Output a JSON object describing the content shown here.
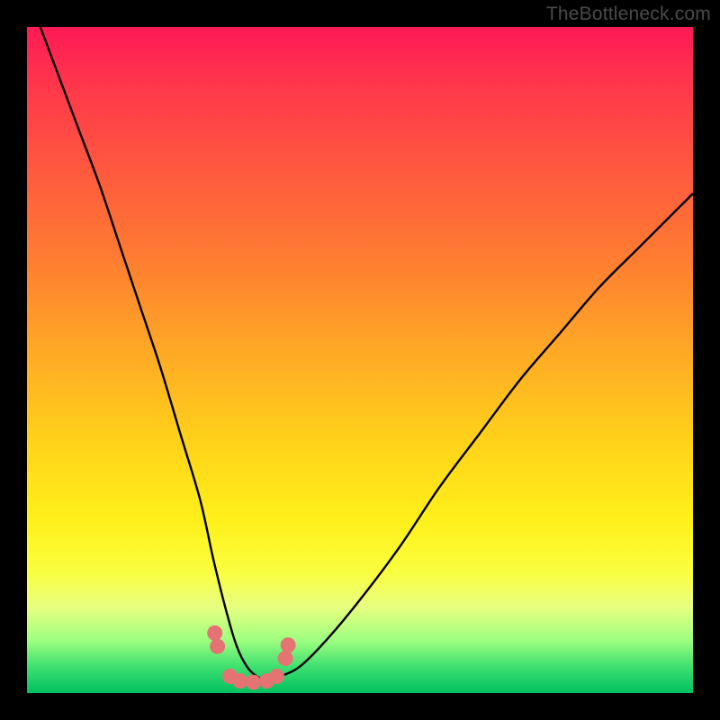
{
  "watermark": "TheBottleneck.com",
  "chart_data": {
    "type": "line",
    "title": "",
    "xlabel": "",
    "ylabel": "",
    "xlim": [
      0,
      100
    ],
    "ylim": [
      0,
      100
    ],
    "grid": false,
    "legend": false,
    "series": [
      {
        "name": "bottleneck-curve",
        "color": "#000000",
        "x": [
          2,
          5,
          8,
          11,
          14,
          17,
          20,
          23,
          26,
          28,
          30,
          31.5,
          33,
          34.5,
          36,
          38,
          41,
          45,
          50,
          56,
          62,
          68,
          74,
          80,
          86,
          92,
          98,
          100
        ],
        "y": [
          100,
          92,
          84,
          76,
          67,
          58,
          49,
          39,
          29,
          20,
          12,
          7,
          4,
          2.5,
          2,
          2.5,
          4,
          8,
          14,
          22,
          31,
          39,
          47,
          54,
          61,
          67,
          73,
          75
        ]
      },
      {
        "name": "marker-dots",
        "color": "#e57373",
        "type": "scatter",
        "x": [
          28.2,
          28.6,
          30.5,
          32.0,
          34.0,
          36.0,
          37.5,
          38.8,
          39.2
        ],
        "y": [
          9.0,
          7.0,
          2.5,
          1.8,
          1.6,
          1.8,
          2.5,
          5.2,
          7.2
        ]
      }
    ],
    "annotations": []
  },
  "colors": {
    "curve": "#000000",
    "markers": "#e57373",
    "frame": "#000000"
  }
}
